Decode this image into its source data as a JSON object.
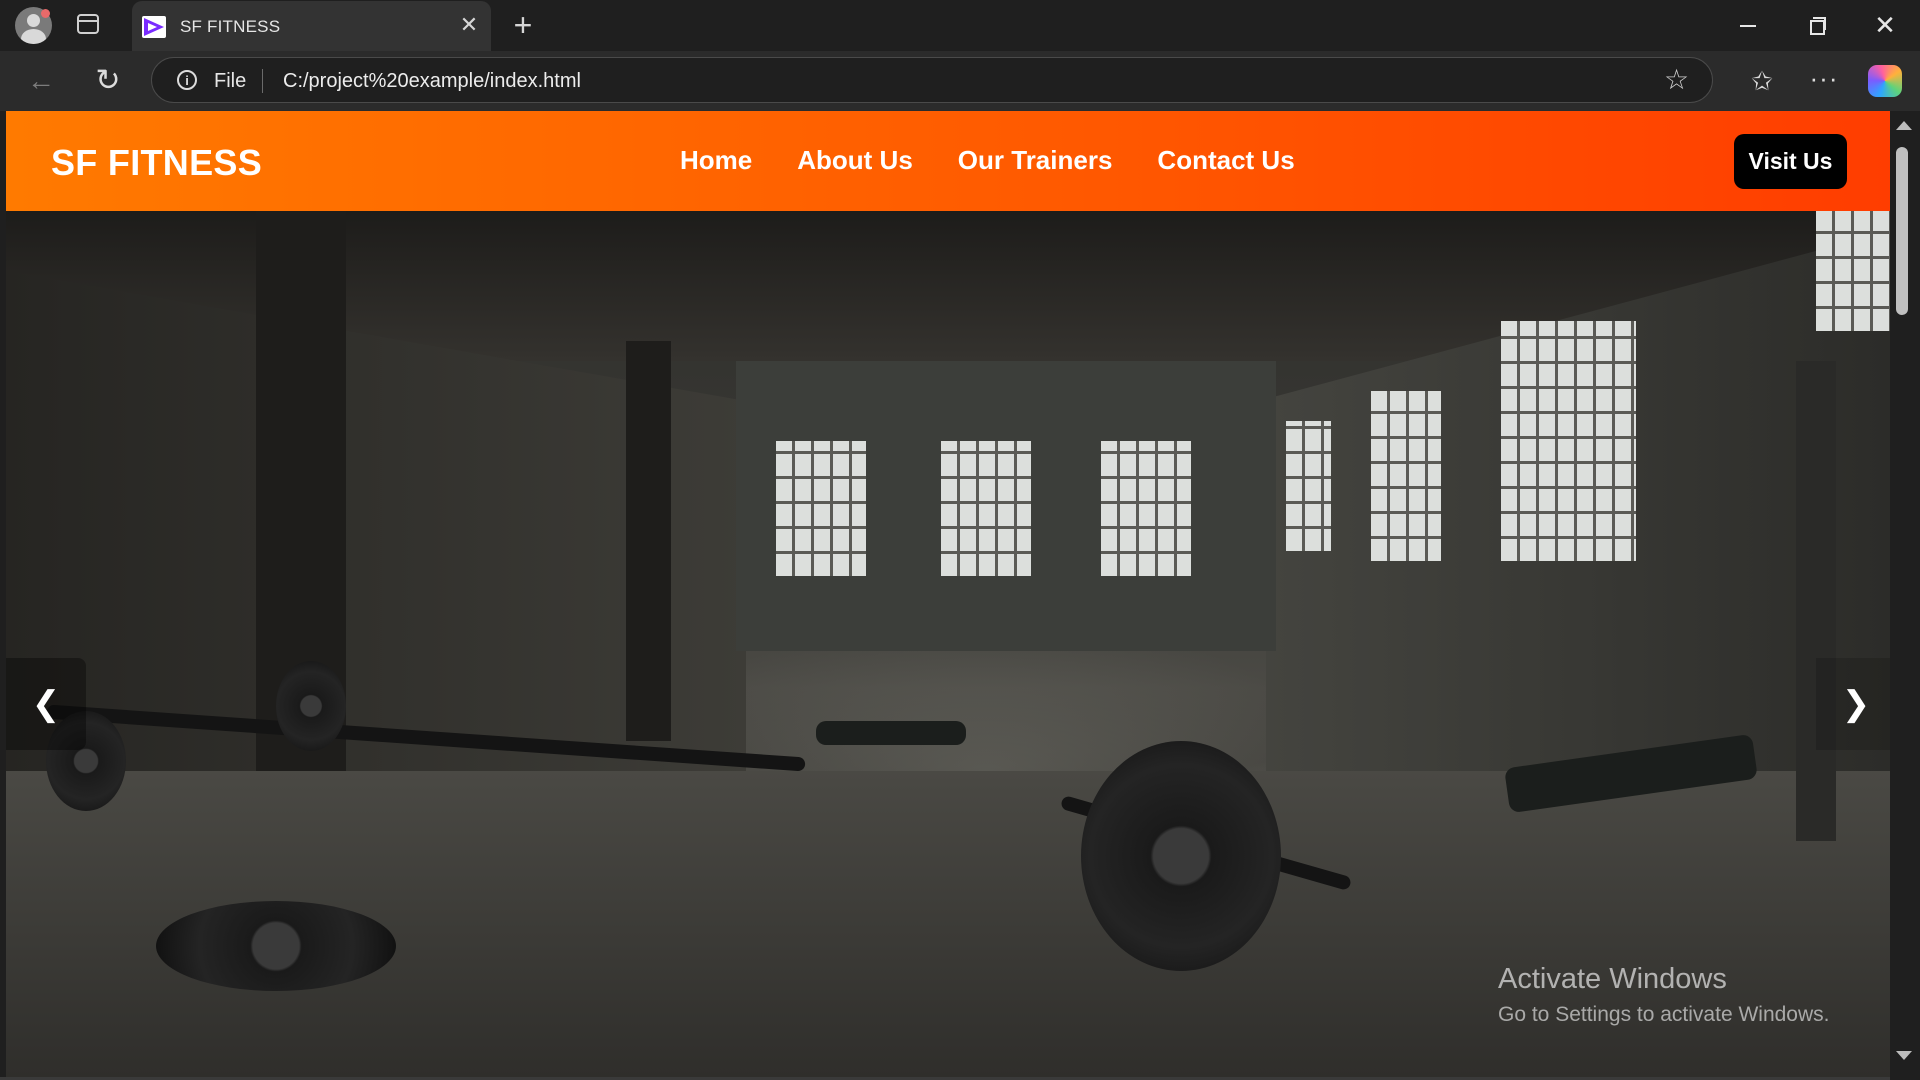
{
  "browser": {
    "tab_title": "SF FITNESS",
    "tab_close": "✕",
    "new_tab": "+",
    "address_scheme": "File",
    "address_url": "C:/project%20example/index.html",
    "back_icon": "←",
    "reload_icon": "↻",
    "star_icon": "☆",
    "favorites_icon": "✩",
    "more_icon": "···",
    "window_close": "✕"
  },
  "site": {
    "logo": "SF FITNESS",
    "nav": [
      "Home",
      "About Us",
      "Our Trainers",
      "Contact Us"
    ],
    "cta": "Visit Us",
    "slider": {
      "prev": "❮",
      "next": "❯"
    },
    "brand_colors": {
      "header_start": "#ff7a00",
      "header_end": "#ff3d00",
      "cta_bg": "#000000"
    }
  },
  "watermark": {
    "title": "Activate Windows",
    "subtitle": "Go to Settings to activate Windows."
  }
}
